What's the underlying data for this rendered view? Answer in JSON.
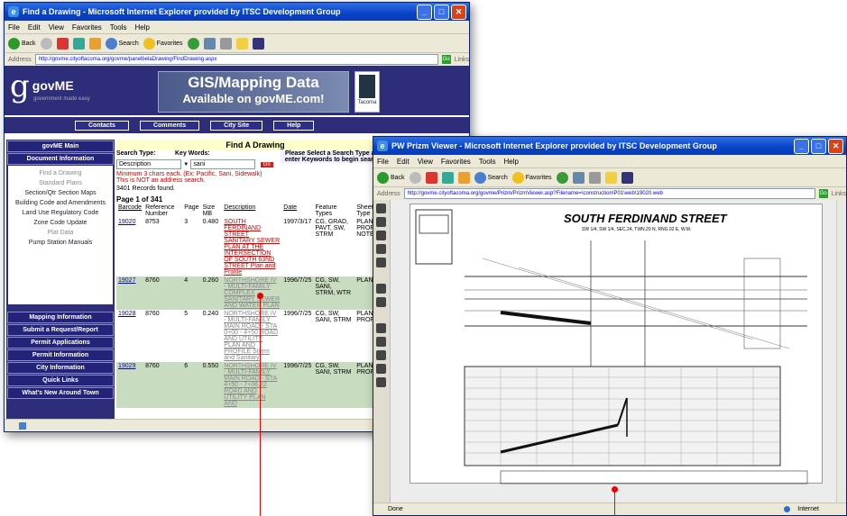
{
  "left_window": {
    "title": "Find a Drawing - Microsoft Internet Explorer provided by ITSC Development Group",
    "menu": [
      "File",
      "Edit",
      "View",
      "Favorites",
      "Tools",
      "Help"
    ],
    "toolbar": {
      "back": "Back",
      "search": "Search",
      "favorites": "Favorites"
    },
    "address_label": "Address",
    "address_url": "http://govme.cityoftacoma.org/govme/panelbelaDrawing/FindDrawing.aspx",
    "go": "Go",
    "links": "Links",
    "logo": {
      "mark": "g",
      "name": "govME",
      "tagline": "government made easy"
    },
    "banner": {
      "line1": "GIS/Mapping Data",
      "line2": "Available on govME.com!",
      "seal": "Tacoma"
    },
    "nav": [
      "Contacts",
      "Comments",
      "City Site",
      "Help"
    ],
    "sidebar_head": "govME Main",
    "sidebar_sub": "Document Information",
    "sidebar_items": [
      {
        "label": "Find a Drawing",
        "dim": true
      },
      {
        "label": "Standard Plans",
        "dim": true
      },
      {
        "label": "Section/Qtr Section Maps",
        "dim": false
      },
      {
        "label": "Building Code and Amendments",
        "dim": false
      },
      {
        "label": "Land Use Regulatory Code",
        "dim": false
      },
      {
        "label": "Zone Code Update",
        "dim": false
      },
      {
        "label": "Plat Data",
        "dim": true
      },
      {
        "label": "Pump Station Manuals",
        "dim": false
      }
    ],
    "sidebar_sections": [
      "Mapping Information",
      "Submit a Request/Report",
      "Permit Applications",
      "Permit Information",
      "City Information",
      "Quick Links",
      "What's New Around Town"
    ],
    "find_header": "Find A Drawing",
    "search_type_label": "Search Type:",
    "key_words_label": "Key Words:",
    "search_type_value": "Description",
    "key_words_value": "sani",
    "go_button": "Go",
    "search_help": "Please Select a Search Type and enter Keywords to begin search!",
    "warning": "Minimum 3 chars each. (Ex: Pacific, Sani, Sidewalk) This is NOT an address search.",
    "records": "3401 Records found.",
    "page": "Page 1 of 341",
    "columns": [
      "Barcode",
      "Reference Number",
      "Page",
      "Size MB",
      "Description",
      "Date",
      "Feature Types",
      "Sheet Type"
    ],
    "rows": [
      {
        "barcode": "19020",
        "ref": "8753",
        "page": "3",
        "size": "0.480",
        "desc": "SOUTH FERDINAND STREET SANITARY SEWER PLAN AT THE INTERSECTION OF SOUTH 63ND STREET Plan and Profile",
        "date": "1997/3/17",
        "feature": "CG, GRAD, PAVT, SW, STRM",
        "sheet": "PLAN, PROF, NOTE"
      },
      {
        "barcode": "19027",
        "ref": "8760",
        "page": "4",
        "size": "0.260",
        "desc": "NORTHSHORE IV - MULTI-FAMILY COMPLEX SANITARY SEWER AND WATER PLAN",
        "date": "1996/7/25",
        "feature": "CG, SW, SANI, STRM, WTR",
        "sheet": "PLAN"
      },
      {
        "barcode": "19028",
        "ref": "8760",
        "page": "5",
        "size": "0.240",
        "desc": "NORTHSHORE IV - MULTI-FAMILY MAIN ROAD - STA 0+00 - 4+50 ROAD AND UTILITY PLAN AND PROFILE Storm and Sanitary",
        "date": "1996/7/25",
        "feature": "CG, SW, SANI, STRM",
        "sheet": "PLAN, PROF"
      },
      {
        "barcode": "19029",
        "ref": "8760",
        "page": "6",
        "size": "0.550",
        "desc": "NORTHSHORE IV - MULTI-FAMILY MAIN ROAD - STA 4+50 - 7+06.22 ROAD AND UTILITY PLAN AND",
        "date": "1996/7/25",
        "feature": "CG, SW, SANI, STRM",
        "sheet": "PLAN, PROF"
      }
    ]
  },
  "right_window": {
    "title": "PW Prizm Viewer - Microsoft Internet Explorer provided by ITSC Development Group",
    "menu": [
      "File",
      "Edit",
      "View",
      "Favorites",
      "Tools",
      "Help"
    ],
    "address_label": "Address",
    "address_url": "http://govme.cityoftacoma.org/govme/Prizm/PrizmViewer.asp?Filename=\\construction\\P01\\web\\19020.web",
    "go": "Go",
    "links": "Links",
    "drawing_title": "SOUTH FERDINAND STREET",
    "drawing_subtitle": "SW 1/4, SW 1/4, SEC.24, TWN.20 N, RNG.02 E, W.M.",
    "status_left": "Done",
    "status_right": "Internet"
  },
  "colors": {
    "title_bar": "#0842c8",
    "nav_blue": "#2d2d7a",
    "accent_red": "#e00000",
    "row_alt": "#c8dcc0"
  }
}
